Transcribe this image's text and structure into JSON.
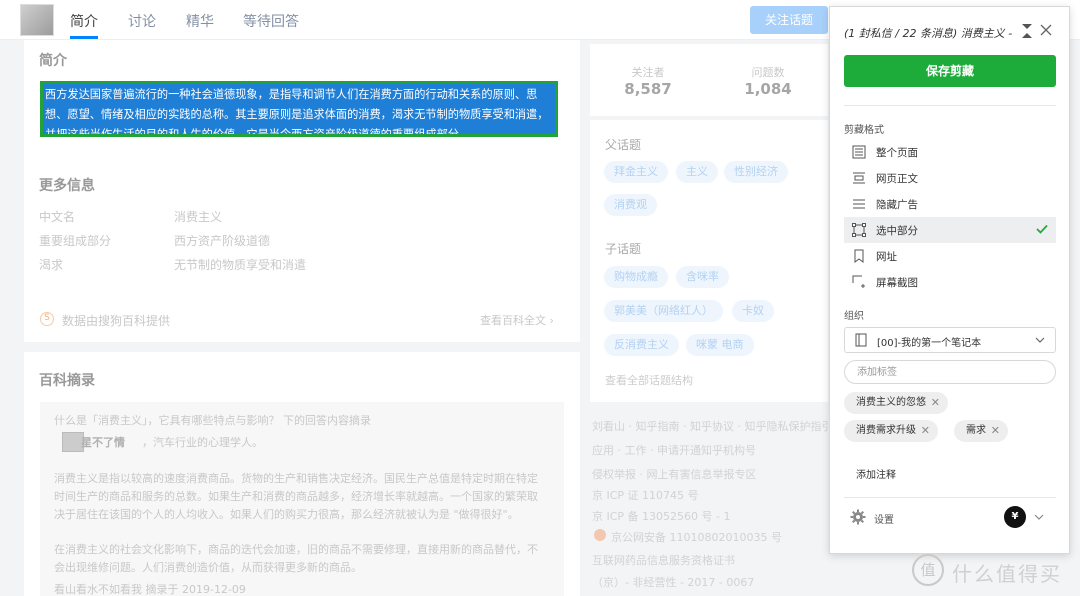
{
  "nav": {
    "tabs": [
      "简介",
      "讨论",
      "精华",
      "等待回答"
    ],
    "follow_button": "关注话题"
  },
  "intro": {
    "title": "简介",
    "selected_text": "西方发达国家普遍流行的一种社会道德现象，是指导和调节人们在消费方面的行动和关系的原则、思想、愿望、情绪及相应的实践的总称。其主要原则是追求体面的消费，渴求无节制的物质享受和消遣，并把这些当作生活的目的和人生的价值。它是当今西方资产阶级道德的重要组成部分。",
    "more_title": "更多信息",
    "info": [
      {
        "label": "中文名",
        "value": "消费主义"
      },
      {
        "label": "重要组成部分",
        "value": "西方资产阶级道德"
      },
      {
        "label": "渴求",
        "value": "无节制的物质享受和消遣"
      }
    ],
    "source_icon": "S",
    "source": "数据由搜狗百科提供",
    "full_text_link": "查看百科全文 ›"
  },
  "baike": {
    "title": "百科摘录",
    "question": "什么是「消费主义」，它具有哪些特点与影响？ 下的回答内容摘录",
    "author": "星不了情",
    "author_desc": "，汽车行业的心理学人。",
    "para1_line1": "消费主义是指以较高的速度消费商品。货物的生产和销售决定经济。国民生产总值是特定时期在特定",
    "para1_line2": "时间生产的商品和服务的总数。如果生产和消费的商品越多，经济增长率就越高。一个国家的繁荣取",
    "para1_line3": "决于居住在该国的个人的人均收入。如果人们的购买力很高，那么经济就被认为是 \"做得很好\"。",
    "para2_line1": "在消费主义的社会文化影响下，商品的迭代会加速，旧的商品不需要修理，直接用新的商品替代，不",
    "para2_line2": "会出现维修问题。人们消费创造价值，从而获得更多新的商品。",
    "date_line": "看山看水不如看我 摘录于 2019-12-09"
  },
  "stats": [
    {
      "label": "关注者",
      "value": "8,587"
    },
    {
      "label": "问题数",
      "value": "1,084"
    }
  ],
  "topics": {
    "parent_title": "父话题",
    "parent": [
      "拜金主义",
      "主义",
      "性别经济",
      "消费观"
    ],
    "child_title": "子话题",
    "child": [
      "购物成瘾",
      "含咪率",
      "郭美美（网络红人）",
      "卡奴",
      "反消费主义",
      "咪蒙 电商"
    ],
    "all_link": "查看全部话题结构"
  },
  "footer": [
    "刘看山 · 知乎指南 · 知乎协议 · 知乎隐私保护指引",
    "应用 · 工作 · 申请开通知乎机构号",
    "侵权举报 · 网上有害信息举报专区",
    "京 ICP 证 110745 号",
    "京 ICP 备 13052560 号 - 1",
    "京公网安备 11010802010035 号",
    "互联网药品信息服务资格证书",
    "（京）- 非经营性 - 2017 - 0067"
  ],
  "clipper": {
    "title": "(1 封私信 / 22 条消息) 消费主义 -",
    "save_button": "保存剪藏",
    "format_label": "剪藏格式",
    "formats": [
      {
        "label": "整个页面",
        "icon": "full-page-icon"
      },
      {
        "label": "网页正文",
        "icon": "article-icon"
      },
      {
        "label": "隐藏广告",
        "icon": "hide-ads-icon"
      },
      {
        "label": "选中部分",
        "icon": "selection-icon",
        "selected": true
      },
      {
        "label": "网址",
        "icon": "bookmark-icon"
      },
      {
        "label": "屏幕截图",
        "icon": "screenshot-icon"
      }
    ],
    "organize_label": "组织",
    "notebook": "[00]-我的第一个笔记本",
    "tag_placeholder": "添加标签",
    "tags": [
      "消费主义的忽悠",
      "消费需求升级",
      "需求"
    ],
    "add_note": "添加注释",
    "settings": "设置",
    "account_initial": "¥",
    "accent_color": "#1dac3a"
  },
  "watermark": {
    "text": "什么值得买",
    "icon": "值"
  }
}
